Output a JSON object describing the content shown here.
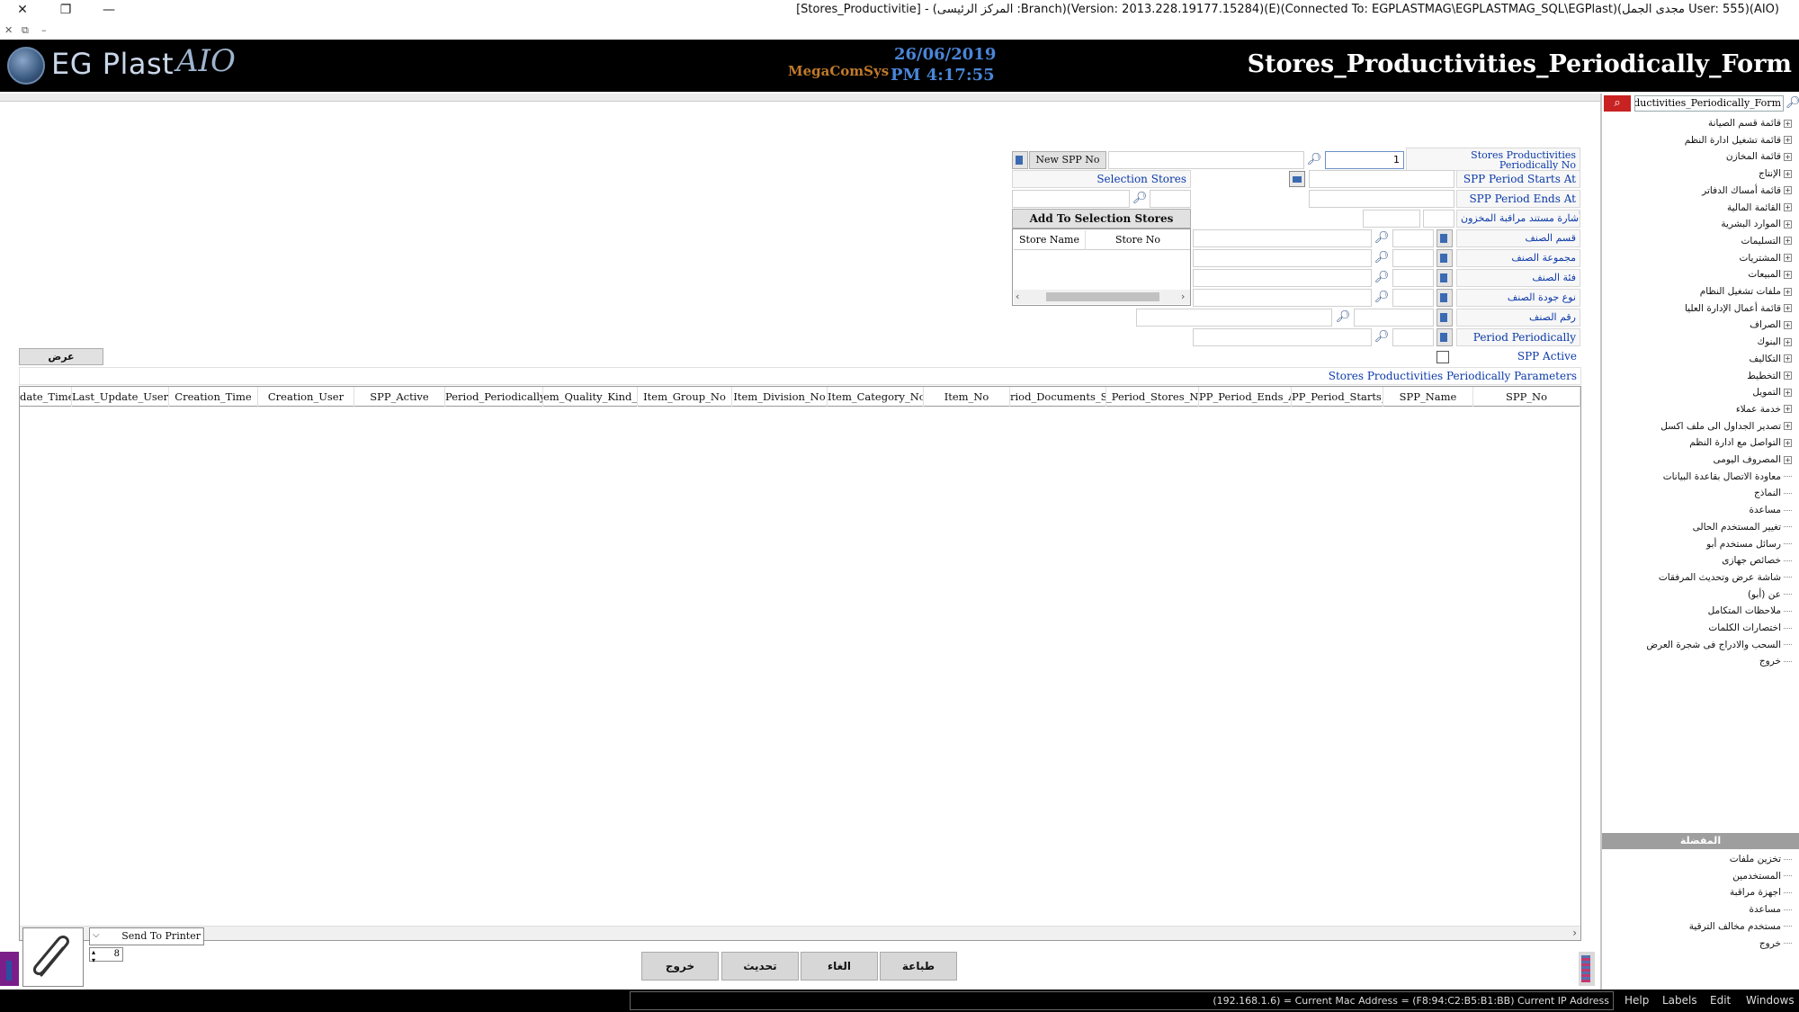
{
  "window": {
    "title": "[Stores_Productivitie] - (المركز الرئيسى :Branch)(Version: 2013.228.19177.15284)(E)(Connected To: EGPLASTMAG\\EGPLASTMAG_SQL\\EGPlast)(مجدى الجمل User: 555)(AIO)",
    "close_glyph": "✕",
    "restore_glyph": "❐",
    "minimize_glyph": "—",
    "sub_icons": [
      "✕",
      "⧉",
      "–"
    ]
  },
  "banner": {
    "logo_text": "EG Plast",
    "logo_suffix": "AIO",
    "brand_mark": "MegaComSys",
    "date": "26/06/2019",
    "time": "PM 4:17:55",
    "form_title": "Stores_Productivities_Periodically_Form"
  },
  "form": {
    "spp_no_label": "Stores Productivities Periodically No",
    "spp_no_value": "1",
    "new_spp_button": "New SPP No",
    "period_starts_label": "SPP Period Starts At",
    "period_ends_label": "SPP Period Ends At",
    "inventory_doc_label": "أشارة مستند مراقبة المخزون",
    "selection_stores_label": "Selection Stores",
    "add_to_selection_button": "Add To Selection Stores",
    "stores_table_headers": [
      "Store Name",
      "Store No"
    ],
    "item_division_label": "قسم الصنف",
    "item_group_label": "مجموعة الصنف",
    "item_category_label": "فئة الصنف",
    "item_quality_label": "نوع جودة الصنف",
    "item_no_label": "رقم الصنف",
    "period_periodically_label": "Period Periodically",
    "spp_active_label": "SPP Active",
    "show_button": "عرض",
    "parameters_label": "Stores Productivities Periodically Parameters"
  },
  "grid": {
    "columns": [
      "SPP_No",
      "SPP_Name",
      "SPP_Period_Starts_At",
      "SPP_Period_Ends_At",
      "SPP_Period_Stores_Numbers",
      "SPP_Period_Documents_Signal",
      "Item_No",
      "Item_Category_No",
      "Item_Division_No",
      "Item_Group_No",
      "Item_Quality_Kind_No",
      "Period_Periodically",
      "SPP_Active",
      "Creation_User",
      "Creation_Time",
      "Last_Update_User",
      "Last_Update_Time"
    ],
    "column_visible_text": [
      "SPP_No",
      "SPP_Name",
      "PP_Period_Starts_A",
      "PP_Period_Ends_A",
      "_Period_Stores_Num",
      "riod_Documents_Sig",
      "Item_No",
      "Item_Category_No",
      "Item_Division_No",
      "Item_Group_No",
      "em_Quality_Kind_N",
      "Period_Periodically",
      "SPP_Active",
      "Creation_User",
      "Creation_Time",
      "Last_Update_User",
      "date_Time"
    ]
  },
  "bottom_bar": {
    "send_to_printer": "Send To Printer",
    "copies": "8",
    "buttons": [
      "طباعة",
      "الغاء",
      "تحديث",
      "خروج"
    ]
  },
  "side_panel": {
    "search_value": "Stores_Productivities_Periodically_Form",
    "tree_items": [
      {
        "label": "قائمة قسم الصيانة",
        "expandable": true
      },
      {
        "label": "قائمة تشغيل ادارة النظم",
        "expandable": true
      },
      {
        "label": "قائمة المخازن",
        "expandable": true
      },
      {
        "label": "الإنتاج",
        "expandable": true
      },
      {
        "label": "قائمة أمساك الدفاتر",
        "expandable": true
      },
      {
        "label": "القائمة المالية",
        "expandable": true
      },
      {
        "label": "الموارد البشرية",
        "expandable": true
      },
      {
        "label": "التسليمات",
        "expandable": true
      },
      {
        "label": "المشتريات",
        "expandable": true
      },
      {
        "label": "المبيعات",
        "expandable": true
      },
      {
        "label": "ملفات تشغيل النظام",
        "expandable": true
      },
      {
        "label": "قائمة أعمال الإدارة العليا",
        "expandable": true
      },
      {
        "label": "الصراف",
        "expandable": true
      },
      {
        "label": "البنوك",
        "expandable": true
      },
      {
        "label": "التكاليف",
        "expandable": true
      },
      {
        "label": "التخطيط",
        "expandable": true
      },
      {
        "label": "التمويل",
        "expandable": true
      },
      {
        "label": "خدمة عملاء",
        "expandable": true
      },
      {
        "label": "تصدير الجداول الى ملف اكسل",
        "expandable": true
      },
      {
        "label": "التواصل مع ادارة النظم",
        "expandable": true
      },
      {
        "label": "المصروف اليومى",
        "expandable": true
      },
      {
        "label": "معاودة الاتصال بقاعدة البيانات",
        "expandable": false
      },
      {
        "label": "النماذج",
        "expandable": false
      },
      {
        "label": "مساعدة",
        "expandable": false
      },
      {
        "label": "تغيير المستخدم الحالى",
        "expandable": false
      },
      {
        "label": "رسائل مستخدم أبو",
        "expandable": false
      },
      {
        "label": "خصائص جهازى",
        "expandable": false
      },
      {
        "label": "شاشة عرض وتحديث المرفقات",
        "expandable": false
      },
      {
        "label": "عن (أبو)",
        "expandable": false
      },
      {
        "label": "ملاحظات المتكامل",
        "expandable": false
      },
      {
        "label": "اختصارات الكلمات",
        "expandable": false
      },
      {
        "label": "السحب والادراج فى شجرة العرض",
        "expandable": false
      },
      {
        "label": "خروج",
        "expandable": false
      }
    ],
    "bottom_section_title": "المفضلة",
    "bottom_items": [
      "تخزين ملفات",
      "المستخدمين",
      "اجهزة مراقبة",
      "مساعدة",
      "مستخدم مخالف الترقية",
      "خروج"
    ]
  },
  "status_bar": {
    "text": "(192.168.1.6) = Current Mac Address = (F8:94:C2:B5:B1:BB) Current IP Address",
    "menu": [
      "Help",
      "Labels",
      "Edit",
      "Windows"
    ]
  }
}
